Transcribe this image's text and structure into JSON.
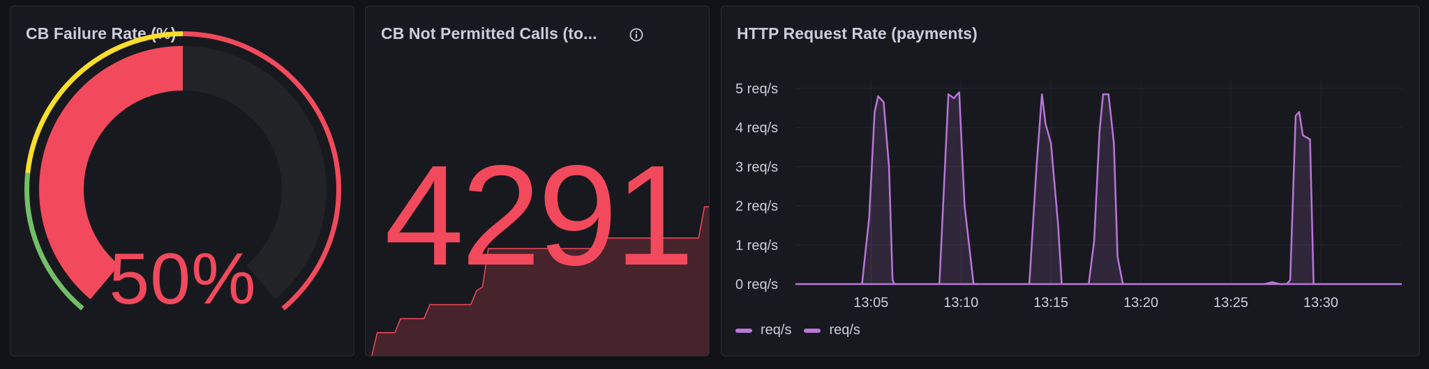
{
  "panels": {
    "failure_rate": {
      "title": "CB Failure Rate (%)",
      "value": 50,
      "value_text": "50%",
      "min": 0,
      "max": 100,
      "color": "#f2495c",
      "thresholds": [
        {
          "from": 0,
          "to": 20,
          "color": "#73bf69"
        },
        {
          "from": 20,
          "to": 50,
          "color": "#fade2a"
        },
        {
          "from": 50,
          "to": 100,
          "color": "#f2495c"
        }
      ]
    },
    "not_permitted": {
      "title": "CB Not Permitted Calls (to...",
      "info_icon": "info-circle-icon",
      "value_text": "4291",
      "color": "#f2495c",
      "sparkline": {
        "color": "#f2495c",
        "fill": "rgba(242,73,92,0.22)",
        "values": [
          0,
          0,
          700,
          700,
          700,
          700,
          1100,
          1100,
          1100,
          1100,
          1100,
          1500,
          1500,
          1500,
          1500,
          1500,
          1500,
          1500,
          1500,
          1900,
          2000,
          3100,
          3100,
          3100,
          3100,
          3100,
          3100,
          3100,
          3100,
          3100,
          3100,
          3100,
          3100,
          3100,
          3100,
          3100,
          3100,
          3100,
          3100,
          3100,
          3400,
          3400,
          3400,
          3400,
          3400,
          3400,
          3400,
          3400,
          3400,
          3400,
          3400,
          3400,
          3400,
          3400,
          3400,
          3400,
          3400,
          3400,
          4291,
          4291
        ]
      }
    },
    "http_rate": {
      "title": "HTTP Request Rate (payments)",
      "legend": [
        {
          "label": "req/s",
          "color": "#b877d9"
        },
        {
          "label": "req/s",
          "color": "#b877d9"
        }
      ]
    }
  },
  "chart_data": {
    "type": "line",
    "title": "HTTP Request Rate (payments)",
    "xlabel": "",
    "ylabel": "",
    "x_tick_labels": [
      "13:05",
      "13:10",
      "13:15",
      "13:20",
      "13:25",
      "13:30"
    ],
    "y_tick_labels": [
      "0 req/s",
      "1 req/s",
      "2 req/s",
      "3 req/s",
      "4 req/s",
      "5 req/s"
    ],
    "ylim": [
      0,
      5
    ],
    "x_unit": "minutes after 13:00",
    "grid": true,
    "legend_position": "bottom-left",
    "series": [
      {
        "name": "req/s",
        "color": "#b877d9",
        "fill": "rgba(184,119,217,0.15)",
        "x": [
          4.5,
          4.9,
          5.2,
          5.4,
          5.7,
          6.0,
          6.2,
          6.3,
          6.4
        ],
        "y": [
          0,
          1.7,
          4.4,
          4.8,
          4.65,
          3.0,
          0.1,
          0,
          0
        ]
      },
      {
        "name": "req/s",
        "color": "#b877d9",
        "fill": "rgba(184,119,217,0.15)",
        "x": [
          8.8,
          9.3,
          9.6,
          9.9,
          10.2,
          10.7,
          11.0
        ],
        "y": [
          0,
          4.85,
          4.75,
          4.9,
          2.0,
          0,
          0
        ]
      },
      {
        "name": "req/s",
        "color": "#b877d9",
        "fill": "rgba(184,119,217,0.15)",
        "x": [
          13.8,
          14.2,
          14.5,
          14.7,
          15.0,
          15.4,
          15.6
        ],
        "y": [
          0,
          3.0,
          4.85,
          4.1,
          3.6,
          1.5,
          0
        ]
      },
      {
        "name": "req/s",
        "color": "#b877d9",
        "fill": "rgba(184,119,217,0.15)",
        "x": [
          17.1,
          17.4,
          17.7,
          17.9,
          18.2,
          18.5,
          18.7,
          19.0
        ],
        "y": [
          0,
          1.1,
          3.9,
          4.85,
          4.85,
          3.6,
          0.7,
          0
        ]
      },
      {
        "name": "req/s",
        "color": "#b877d9",
        "fill": "rgba(184,119,217,0.15)",
        "x": [
          26.9,
          27.3,
          27.7,
          28.1,
          28.3,
          28.6,
          28.8,
          29.0,
          29.4,
          29.6
        ],
        "y": [
          0,
          0.05,
          0,
          0,
          0.1,
          4.3,
          4.4,
          3.8,
          3.7,
          0
        ]
      }
    ],
    "baseline": {
      "x": [
        0,
        34.5
      ],
      "y": [
        0,
        0
      ]
    },
    "x_range": [
      0.8,
      34.5
    ]
  }
}
